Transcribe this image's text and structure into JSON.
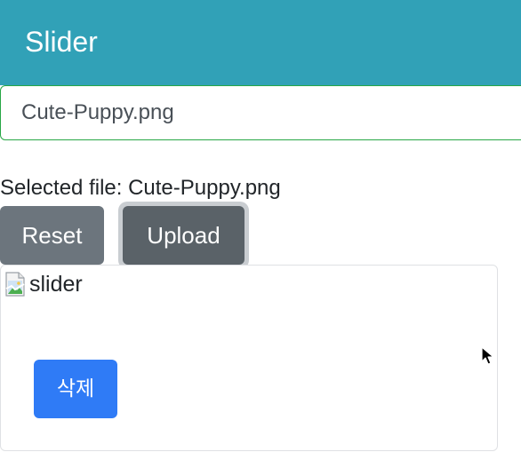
{
  "header": {
    "title": "Slider",
    "background_color": "#31a1b7"
  },
  "file_input": {
    "value": "Cute-Puppy.png",
    "border_color": "#28a745"
  },
  "selection": {
    "text": "Selected file: Cute-Puppy.png"
  },
  "buttons": {
    "reset_label": "Reset",
    "upload_label": "Upload"
  },
  "slider_card": {
    "image_alt": "slider",
    "delete_label": "삭제",
    "delete_color": "#2f7bf6"
  },
  "icons": {
    "broken_image": "broken-image-icon",
    "cursor": "mouse-pointer-icon"
  }
}
